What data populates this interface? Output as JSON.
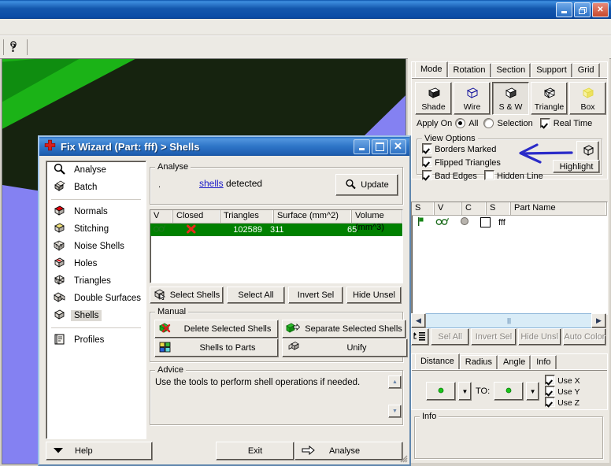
{
  "window": {
    "title": "",
    "controls": {
      "minimize": "minimize-icon",
      "restore": "restore-icon",
      "close": "close-icon"
    },
    "toolbar": {
      "help_glyph": "?"
    }
  },
  "viewport": {
    "name": "3d-viewport",
    "background_color": "#16230f",
    "green_color": "#1bb317",
    "purple_color": "#8481f2"
  },
  "right_panel": {
    "tabs": [
      {
        "label": "Mode",
        "active": true
      },
      {
        "label": "Rotation",
        "active": false
      },
      {
        "label": "Section",
        "active": false
      },
      {
        "label": "Support",
        "active": false
      },
      {
        "label": "Grid",
        "active": false
      }
    ],
    "mode_buttons": [
      {
        "label": "Shade",
        "icon": "shade-cube-icon",
        "pressed": false
      },
      {
        "label": "Wire",
        "icon": "wire-cube-icon",
        "pressed": false
      },
      {
        "label": "S & W",
        "icon": "shade-wire-cube-icon",
        "pressed": true
      },
      {
        "label": "Triangle",
        "icon": "triangle-cube-icon",
        "pressed": false
      },
      {
        "label": "Box",
        "icon": "box-icon",
        "pressed": false
      }
    ],
    "apply_on": {
      "label": "Apply On",
      "options": [
        {
          "label": "All",
          "selected": true
        },
        {
          "label": "Selection",
          "selected": false
        }
      ],
      "real_time": {
        "label": "Real Time",
        "checked": true
      }
    },
    "view_options": {
      "legend": "View Options",
      "items": [
        {
          "label": "Borders Marked",
          "checked": true
        },
        {
          "label": "Flipped Triangles",
          "checked": true
        },
        {
          "label": "Bad Edges",
          "checked": true
        },
        {
          "label": "Hidden Line",
          "checked": false
        }
      ],
      "highlight_button": "Highlight",
      "cube_button_icon": "wireframe-cube-icon"
    },
    "parts_list": {
      "columns": [
        "S",
        "V",
        "C",
        "S",
        "Part Name"
      ],
      "rows": [
        {
          "s_icon": "flag-icon",
          "v_icon": "glasses-icon",
          "c_icon": "circle-icon",
          "s2_icon": "checkbox-icon",
          "part_name": "fff"
        }
      ]
    },
    "hscroll": {
      "left_arrow": "◀",
      "right_arrow": "▶",
      "thumb": "||||"
    },
    "parts_toolbar": {
      "tree_icon": "tree-select-icon",
      "buttons": [
        {
          "label": "Sel  All",
          "disabled": true
        },
        {
          "label": "Invert Sel",
          "disabled": true
        },
        {
          "label": "Hide Unsl",
          "disabled": true
        },
        {
          "label": "Auto Color",
          "disabled": true
        }
      ]
    },
    "measure": {
      "tabs": [
        {
          "label": "Distance",
          "active": true
        },
        {
          "label": "Radius",
          "active": false
        },
        {
          "label": "Angle",
          "active": false
        },
        {
          "label": "Info",
          "active": false
        }
      ],
      "from_picker": {
        "icon": "green-dot-icon",
        "dropdown": "▼"
      },
      "to_label": "TO:",
      "to_picker": {
        "icon": "green-dot-icon",
        "dropdown": "▼"
      },
      "axes": [
        {
          "label": "Use X",
          "checked": true
        },
        {
          "label": "Use Y",
          "checked": true
        },
        {
          "label": "Use Z",
          "checked": true
        }
      ]
    },
    "info": {
      "legend": "Info",
      "content": ""
    }
  },
  "dialog": {
    "title": "Fix Wizard (Part: fff) > Shells",
    "icon": "red-cross-icon",
    "controls": {
      "minimize": "minimize-icon",
      "maximize": "maximize-icon",
      "close": "close-icon"
    },
    "sidebar": [
      {
        "label": "Analyse",
        "icon": "magnifier-icon",
        "selected": false
      },
      {
        "label": "Batch",
        "icon": "batch-cubes-icon",
        "selected": false
      },
      {
        "separator": true
      },
      {
        "label": "Normals",
        "icon": "normals-cube-icon",
        "selected": false
      },
      {
        "label": "Stitching",
        "icon": "stitching-cube-icon",
        "selected": false
      },
      {
        "label": "Noise Shells",
        "icon": "noise-shells-icon",
        "selected": false
      },
      {
        "label": "Holes",
        "icon": "holes-cube-icon",
        "selected": false
      },
      {
        "label": "Triangles",
        "icon": "triangles-cube-icon",
        "selected": false
      },
      {
        "label": "Double Surfaces",
        "icon": "double-surfaces-icon",
        "selected": false
      },
      {
        "label": "Shells",
        "icon": "shells-cube-icon",
        "selected": true
      },
      {
        "separator": true
      },
      {
        "label": "Profiles",
        "icon": "profiles-icon",
        "selected": false
      }
    ],
    "analyse": {
      "legend": "Analyse",
      "count": ".",
      "link_text": "shells",
      "after_text": " detected",
      "update_button": {
        "label": "Update",
        "icon": "magnifier-icon"
      }
    },
    "table": {
      "columns": [
        "V",
        "Closed",
        "Triangles",
        "Surface (mm^2)",
        "Volume (mm^3)"
      ],
      "rows": [
        {
          "v_icon": "glasses-icon",
          "closed_icon": "red-x-icon",
          "triangles": "102589",
          "surface": "311",
          "volume": "65",
          "selected": true
        }
      ],
      "selected_color": "#008000"
    },
    "selection_buttons": [
      {
        "label": "Select Shells",
        "icon": "select-shells-icon"
      },
      {
        "label": "Select All",
        "icon": ""
      },
      {
        "label": "Invert Sel",
        "icon": ""
      },
      {
        "label": "Hide Unsel",
        "icon": ""
      }
    ],
    "manual": {
      "legend": "Manual",
      "buttons": [
        {
          "label": "Delete Selected Shells",
          "icon": "delete-shell-icon"
        },
        {
          "label": "Separate Selected Shells",
          "icon": "separate-shell-icon"
        },
        {
          "label": "Shells to Parts",
          "icon": "shells-to-parts-icon"
        },
        {
          "label": "Unify",
          "icon": "unify-icon"
        }
      ]
    },
    "advice": {
      "legend": "Advice",
      "text": "Use the tools to perform shell operations if needed.",
      "scroll_up": "▲",
      "scroll_down": "▼"
    },
    "footer": {
      "help": {
        "label": "Help",
        "icon": "dropdown-arrow-icon"
      },
      "exit": {
        "label": "Exit"
      },
      "analyse": {
        "label": "Analyse",
        "icon": "right-arrow-icon"
      }
    }
  },
  "annotation": {
    "type": "hand-drawn-arrow",
    "color": "#2b2bc8",
    "points_at": "Borders Marked"
  }
}
